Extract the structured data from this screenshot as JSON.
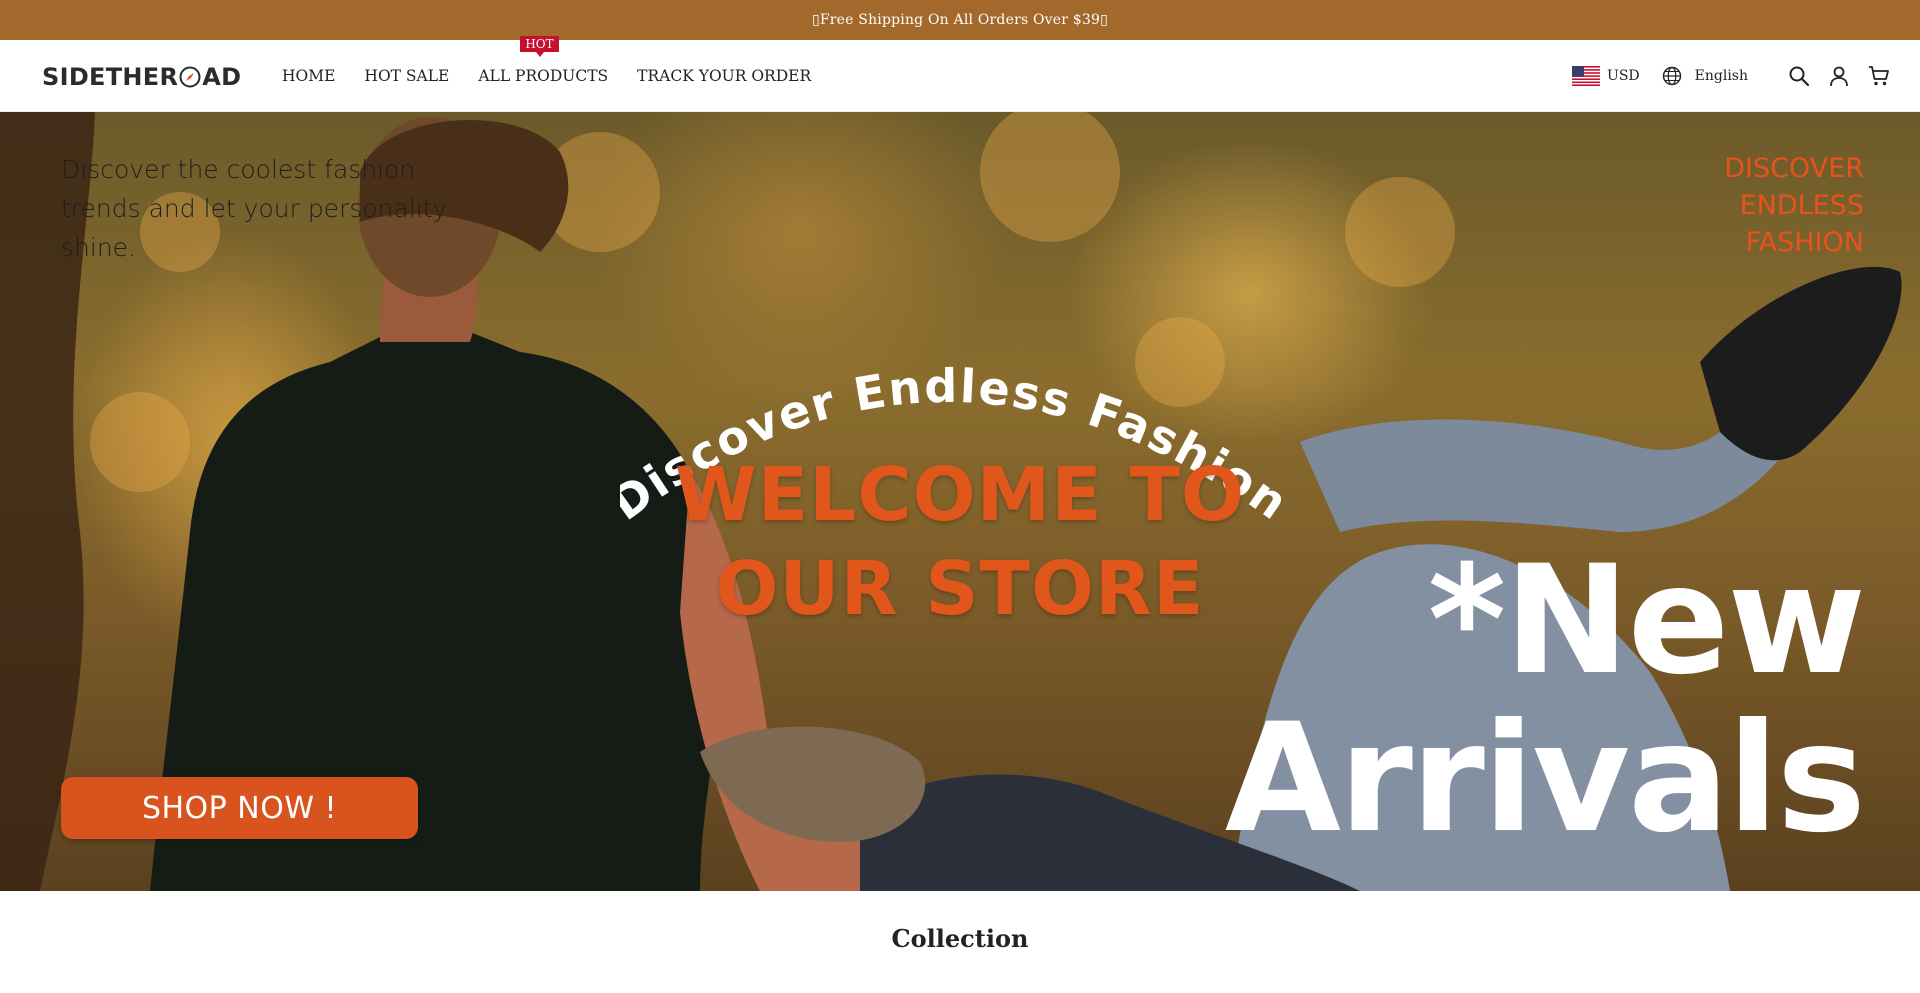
{
  "announcement": {
    "text": "▯Free Shipping On All Orders Over $39▯"
  },
  "header": {
    "logo": {
      "left": "SIDETHER",
      "right": "AD"
    },
    "nav": [
      {
        "label": "HOME"
      },
      {
        "label": "HOT SALE"
      },
      {
        "label": "ALL PRODUCTS",
        "badge": "HOT"
      },
      {
        "label": "TRACK YOUR ORDER"
      }
    ],
    "currency": "USD",
    "language": "English",
    "icons": [
      "globe-icon",
      "search-icon",
      "account-icon",
      "cart-icon"
    ]
  },
  "hero": {
    "tagline": "Discover the coolest fashion trends and let your personality shine.",
    "corner_text": "Discover endless fashion",
    "arc_text": "Discover Endless Fashion",
    "welcome_line1": "WELCOME TO",
    "welcome_line2": "OUR STORE",
    "new_line1": "*New",
    "new_line2": "Arrivals",
    "cta": "SHOP NOW !"
  },
  "collection": {
    "title": "Collection"
  },
  "colors": {
    "announcement_bg": "#a3692c",
    "accent_orange": "#e1561a",
    "cta_bg": "#d9531e",
    "hot_badge": "#c8102e"
  }
}
